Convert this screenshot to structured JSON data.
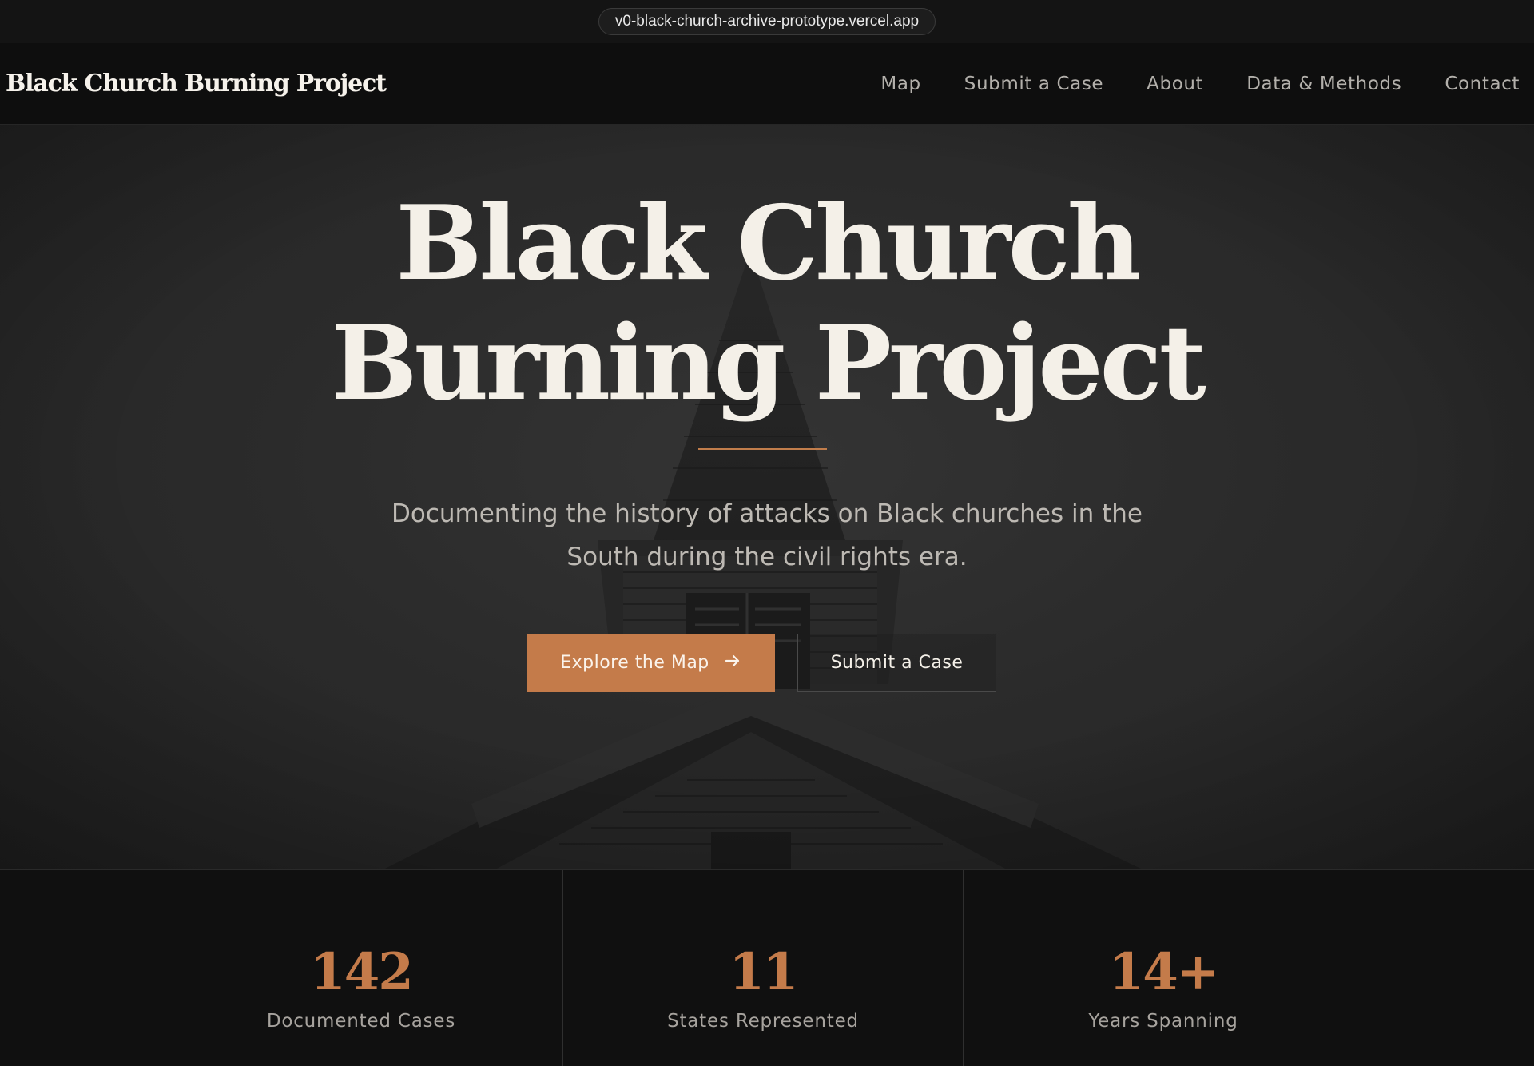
{
  "browser": {
    "url": "v0-black-church-archive-prototype.vercel.app"
  },
  "nav": {
    "brand": "Black Church Burning Project",
    "links": [
      {
        "label": "Map"
      },
      {
        "label": "Submit a Case"
      },
      {
        "label": "About"
      },
      {
        "label": "Data & Methods"
      },
      {
        "label": "Contact"
      }
    ]
  },
  "hero": {
    "title_line1": "Black Church",
    "title_line2": "Burning Project",
    "subtitle_line1": "Documenting the history of attacks on Black churches in the",
    "subtitle_line2": "South during the civil rights era.",
    "primary_button": "Explore the Map",
    "primary_button_icon": "arrow-right-icon",
    "secondary_button": "Submit a Case",
    "background_image": "church-steeple-photo"
  },
  "stats": [
    {
      "value": "142",
      "label": "Documented Cases"
    },
    {
      "value": "11",
      "label": "States Represented"
    },
    {
      "value": "14+",
      "label": "Years Spanning"
    }
  ],
  "colors": {
    "accent": "#c47b4a",
    "background": "#111111",
    "hero_background": "#2b2b2b",
    "text_primary": "#f4f0e8",
    "text_muted": "#b3b0ab"
  }
}
